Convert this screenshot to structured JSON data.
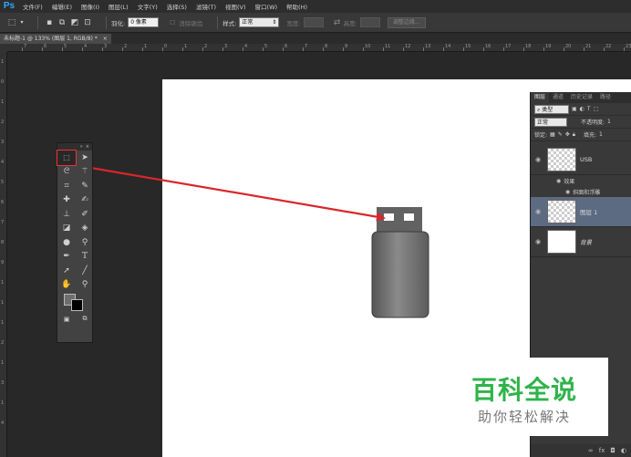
{
  "app": {
    "logo": "Ps"
  },
  "menu": [
    "文件(F)",
    "编辑(E)",
    "图像(I)",
    "图层(L)",
    "文字(Y)",
    "选择(S)",
    "滤镜(T)",
    "视图(V)",
    "窗口(W)",
    "帮助(H)"
  ],
  "options": {
    "feather_label": "羽化:",
    "feather_value": "0 像素",
    "antialias_label": "消除锯齿",
    "style_label": "样式:",
    "style_value": "正常",
    "width_label": "宽度:",
    "height_label": "高度:",
    "refine_button": "调整边缘..."
  },
  "document": {
    "tab_title": "未标题-1 @ 133% (图层 1, RGB/8) *"
  },
  "ruler": {
    "top": [
      "7",
      "6",
      "5",
      "4",
      "3",
      "2",
      "1",
      "0",
      "1",
      "2",
      "3",
      "4",
      "5",
      "6",
      "7",
      "8",
      "9",
      "10",
      "11",
      "12",
      "13",
      "14",
      "15",
      "16",
      "17",
      "18",
      "19",
      "20",
      "21",
      "22",
      "23"
    ],
    "left": [
      "1",
      "0",
      "1",
      "2",
      "3",
      "4",
      "5",
      "6",
      "7",
      "8",
      "9",
      "1",
      "1",
      "1",
      "2",
      "1",
      "3",
      "1",
      "4"
    ]
  },
  "layers_panel": {
    "tabs": [
      "图层",
      "通道",
      "历史记录",
      "路径"
    ],
    "filter_label": "类型",
    "blend_mode": "正常",
    "opacity_label": "不透明度:",
    "opacity_value": "1",
    "lock_label": "锁定:",
    "fill_label": "填充:",
    "fill_value": "1",
    "layers": [
      {
        "name": "USB"
      },
      {
        "name": "图层 1"
      },
      {
        "name": "背景"
      }
    ],
    "effects_label": "效果",
    "effect_name": "斜面和浮雕"
  },
  "watermark": {
    "main": "百科全说",
    "sub": "助你轻松解决"
  },
  "colors": {
    "accent_arrow": "#d9262a",
    "selected_layer": "#5d6b82",
    "watermark_green": "#2fb34a"
  }
}
